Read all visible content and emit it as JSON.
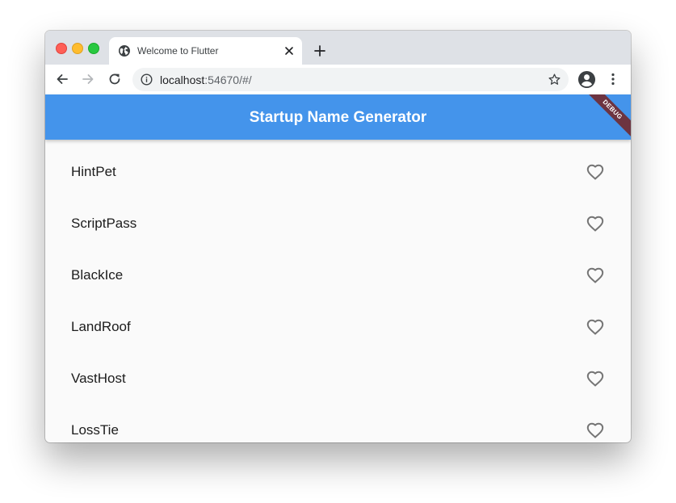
{
  "browser": {
    "tab": {
      "title": "Welcome to Flutter",
      "icon": "globe-icon"
    },
    "address": {
      "host": "localhost",
      "rest": ":54670/#/"
    },
    "icons": [
      "back-arrow-icon",
      "forward-arrow-icon",
      "reload-icon",
      "info-icon",
      "star-icon",
      "profile-icon",
      "menu-dots-icon",
      "close-icon",
      "plus-icon"
    ]
  },
  "app": {
    "title": "Startup Name Generator",
    "debug_banner": "DEBUG",
    "accent_color": "#4494eb",
    "items": [
      {
        "name": "HintPet",
        "favorite": false
      },
      {
        "name": "ScriptPass",
        "favorite": false
      },
      {
        "name": "BlackIce",
        "favorite": false
      },
      {
        "name": "LandRoof",
        "favorite": false
      },
      {
        "name": "VastHost",
        "favorite": false
      },
      {
        "name": "LossTie",
        "favorite": false
      }
    ]
  }
}
